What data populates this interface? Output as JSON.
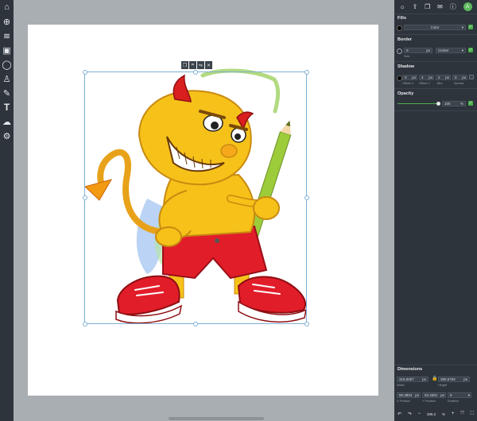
{
  "left_toolbar": [
    {
      "name": "home-icon",
      "glyph": "⌂"
    },
    {
      "name": "add-page-icon",
      "glyph": "⊕"
    },
    {
      "name": "layers-icon",
      "glyph": "≋"
    },
    {
      "name": "image-icon",
      "glyph": "▣"
    },
    {
      "name": "shapes-icon",
      "glyph": "◯"
    },
    {
      "name": "stamp-icon",
      "glyph": "♙"
    },
    {
      "name": "pen-icon",
      "glyph": "✎"
    },
    {
      "name": "text-icon",
      "glyph": "T"
    },
    {
      "name": "upload-cloud-icon",
      "glyph": "☁"
    },
    {
      "name": "settings-icon",
      "glyph": "⚙"
    }
  ],
  "panel_top": [
    {
      "name": "effects-icon",
      "glyph": "☼"
    },
    {
      "name": "export-icon",
      "glyph": "⇪"
    },
    {
      "name": "document-icon",
      "glyph": "❐"
    },
    {
      "name": "comment-icon",
      "glyph": "✉"
    },
    {
      "name": "info-icon",
      "glyph": "ⓘ"
    }
  ],
  "avatar": {
    "letter": "A",
    "color": "#5cb85c"
  },
  "fills": {
    "title": "Fills",
    "type_value": "Color",
    "color": "#000000"
  },
  "border": {
    "title": "Border",
    "size_value": "0",
    "size_unit": "px",
    "style_value": "Center",
    "size_label": "Size"
  },
  "shadow": {
    "title": "Shadow",
    "fields": [
      {
        "value": "0",
        "unit": "px",
        "label": "Offset-X"
      },
      {
        "value": "4",
        "unit": "px",
        "label": "Offset-Y"
      },
      {
        "value": "2",
        "unit": "px",
        "label": "Blur"
      },
      {
        "value": "0",
        "unit": "px",
        "label": "Spread"
      }
    ]
  },
  "opacity": {
    "title": "Opacity",
    "value": "100",
    "unit": "%",
    "level": 0.92
  },
  "dimensions": {
    "title": "Dimensions",
    "width_value": "315.6057",
    "width_unit": "px",
    "width_label": "Width",
    "height_value": "380.5794",
    "height_unit": "px",
    "height_label": "Height",
    "x_value": "50.3804",
    "x_unit": "px",
    "x_label": "X Position",
    "y_value": "52.3361",
    "y_unit": "px",
    "y_label": "Y Position",
    "rotation_value": "0",
    "rotation_label": "Rotation"
  },
  "bottom_bar": {
    "undo": "↶",
    "redo": "↷",
    "zoom_out": "−",
    "zoom_value": "206.2",
    "zoom_unit": "%",
    "zoom_in": "+",
    "fit": "⤧",
    "fullscreen": "⛶"
  },
  "colors": {
    "toolbar_bg": "#2d343b",
    "accent_green": "#4cae4c",
    "selection": "#7fb0d6"
  }
}
